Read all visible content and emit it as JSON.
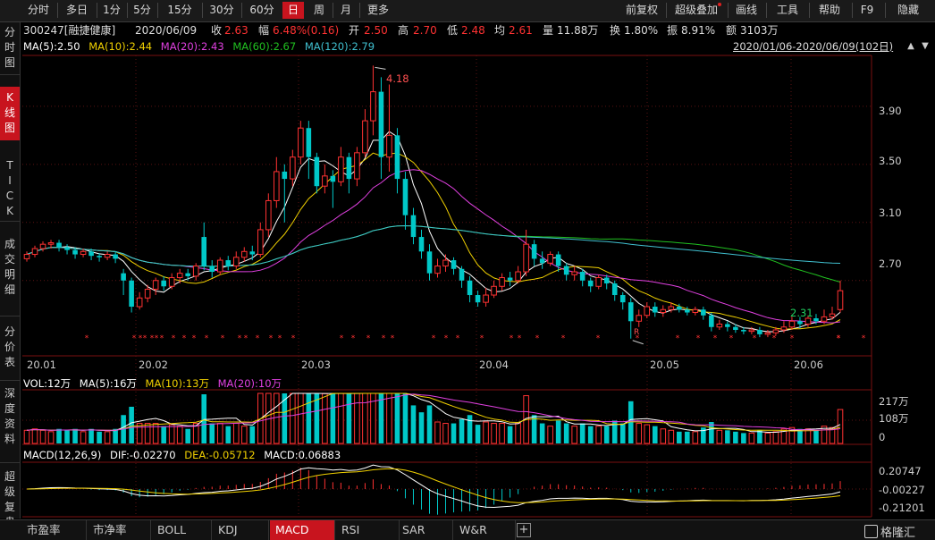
{
  "toolbar": {
    "periods": [
      "分时",
      "多日",
      "1分",
      "5分",
      "15分",
      "30分",
      "60分",
      "日",
      "周",
      "月",
      "更多"
    ],
    "selected": "日",
    "right": [
      "前复权",
      "超级叠加",
      "画线",
      "工具",
      "帮助",
      "F9",
      "隐藏"
    ]
  },
  "left_tabs": [
    "分时图",
    "K线图",
    "TICK",
    "成交明细",
    "分价表",
    "深度资料",
    "超级复盘"
  ],
  "left_selected": "K线图",
  "stock": {
    "code_name": "300247[融捷健康]",
    "date": "2020/06/09",
    "close_label": "收",
    "close": "2.63",
    "change_label": "幅",
    "change": "6.48%(0.16)",
    "open_label": "开",
    "open": "2.50",
    "high_label": "高",
    "high": "2.70",
    "low_label": "低",
    "low": "2.48",
    "avg_label": "均",
    "avg": "2.61",
    "volume_label": "量",
    "volume": "11.88万",
    "turnover_label": "换",
    "turnover": "1.80%",
    "amplitude_label": "振",
    "amplitude": "8.91%",
    "amount_label": "额",
    "amount": "3103万"
  },
  "ma": [
    {
      "label": "MA(5):2.50",
      "color": "#ffffff"
    },
    {
      "label": "MA(10):2.44",
      "color": "#f0d000"
    },
    {
      "label": "MA(20):2.43",
      "color": "#e040e0"
    },
    {
      "label": "MA(60):2.67",
      "color": "#20c020"
    },
    {
      "label": "MA(120):2.79",
      "color": "#40c0d0"
    }
  ],
  "date_range": "2020/01/06-2020/06/09(102日)",
  "price_axis": [
    "3.90",
    "3.50",
    "3.10",
    "2.70"
  ],
  "annotations": {
    "high": "4.18",
    "low": "2.31",
    "r_marker": "R"
  },
  "date_axis": [
    "20.01",
    "20.02",
    "20.03",
    "20.04",
    "20.05",
    "20.06"
  ],
  "vol_panel": {
    "labels": [
      {
        "text": "VOL:12万",
        "color": "#ffffff"
      },
      {
        "text": "MA(5):16万",
        "color": "#ffffff"
      },
      {
        "text": "MA(10):13万",
        "color": "#f0d000"
      },
      {
        "text": "MA(20):10万",
        "color": "#e040e0"
      }
    ],
    "axis": [
      "217万",
      "108万",
      "0"
    ]
  },
  "macd_panel": {
    "labels": [
      {
        "text": "MACD(12,26,9)",
        "color": "#ffffff"
      },
      {
        "text": "DIF:-0.02270",
        "color": "#ffffff"
      },
      {
        "text": "DEA:-0.05712",
        "color": "#f0d000"
      },
      {
        "text": "MACD:0.06883",
        "color": "#ffffff"
      }
    ],
    "axis": [
      "0.20747",
      "-0.00227",
      "-0.21201"
    ]
  },
  "bottom_tabs": [
    "市盈率",
    "市净率",
    "BOLL",
    "KDJ",
    "MACD",
    "RSI",
    "SAR",
    "W&R"
  ],
  "bottom_selected": "MACD",
  "logo": "格隆汇",
  "colors": {
    "up": "#ff3232",
    "down": "#00c8c8",
    "accent": "#c8141e"
  },
  "chart_data": {
    "type": "candlestick",
    "ylim": [
      2.2,
      4.25
    ],
    "candles": [
      [
        2.85,
        2.88,
        2.83,
        2.9
      ],
      [
        2.88,
        2.92,
        2.86,
        2.94
      ],
      [
        2.92,
        2.95,
        2.9,
        2.97
      ],
      [
        2.95,
        2.96,
        2.92,
        2.98
      ],
      [
        2.96,
        2.93,
        2.9,
        2.98
      ],
      [
        2.93,
        2.91,
        2.88,
        2.95
      ],
      [
        2.91,
        2.88,
        2.85,
        2.93
      ],
      [
        2.88,
        2.9,
        2.86,
        2.92
      ],
      [
        2.9,
        2.87,
        2.84,
        2.92
      ],
      [
        2.87,
        2.86,
        2.83,
        2.89
      ],
      [
        2.86,
        2.88,
        2.84,
        2.9
      ],
      [
        2.88,
        2.85,
        2.82,
        2.9
      ],
      [
        2.75,
        2.7,
        2.6,
        2.78
      ],
      [
        2.7,
        2.52,
        2.48,
        2.72
      ],
      [
        2.52,
        2.58,
        2.5,
        2.62
      ],
      [
        2.58,
        2.64,
        2.55,
        2.67
      ],
      [
        2.64,
        2.7,
        2.6,
        2.72
      ],
      [
        2.7,
        2.66,
        2.63,
        2.73
      ],
      [
        2.66,
        2.72,
        2.64,
        2.75
      ],
      [
        2.72,
        2.75,
        2.68,
        2.78
      ],
      [
        2.75,
        2.73,
        2.7,
        2.78
      ],
      [
        2.73,
        2.8,
        2.7,
        2.82
      ],
      [
        3.0,
        2.8,
        2.77,
        3.1
      ],
      [
        2.8,
        2.76,
        2.72,
        2.84
      ],
      [
        2.76,
        2.84,
        2.74,
        2.86
      ],
      [
        2.84,
        2.8,
        2.77,
        2.87
      ],
      [
        2.8,
        2.86,
        2.78,
        2.9
      ],
      [
        2.86,
        2.9,
        2.83,
        2.93
      ],
      [
        2.9,
        2.88,
        2.84,
        2.94
      ],
      [
        2.88,
        3.05,
        2.86,
        3.1
      ],
      [
        3.05,
        3.25,
        3.0,
        3.3
      ],
      [
        3.25,
        3.45,
        3.2,
        3.55
      ],
      [
        3.45,
        3.4,
        3.1,
        3.5
      ],
      [
        3.4,
        3.55,
        3.35,
        3.6
      ],
      [
        3.55,
        3.75,
        3.5,
        3.8
      ],
      [
        3.75,
        3.55,
        3.4,
        3.8
      ],
      [
        3.55,
        3.35,
        3.3,
        3.58
      ],
      [
        3.35,
        3.42,
        3.3,
        3.5
      ],
      [
        3.42,
        3.38,
        3.2,
        3.46
      ],
      [
        3.38,
        3.55,
        3.35,
        3.62
      ],
      [
        3.55,
        3.4,
        3.3,
        3.58
      ],
      [
        3.4,
        3.58,
        3.35,
        3.62
      ],
      [
        3.58,
        3.8,
        3.55,
        3.88
      ],
      [
        3.8,
        4.0,
        3.7,
        4.18
      ],
      [
        4.0,
        3.55,
        3.4,
        4.1
      ],
      [
        3.55,
        3.7,
        3.45,
        4.05
      ],
      [
        3.7,
        3.4,
        3.3,
        3.75
      ],
      [
        3.4,
        3.15,
        3.05,
        3.45
      ],
      [
        3.15,
        3.0,
        2.95,
        3.2
      ],
      [
        3.0,
        2.9,
        2.85,
        3.05
      ],
      [
        2.9,
        2.75,
        2.7,
        2.95
      ],
      [
        2.75,
        2.8,
        2.72,
        2.85
      ],
      [
        2.8,
        2.84,
        2.76,
        2.88
      ],
      [
        2.84,
        2.78,
        2.74,
        2.86
      ],
      [
        2.78,
        2.7,
        2.65,
        2.8
      ],
      [
        2.7,
        2.6,
        2.55,
        2.73
      ],
      [
        2.6,
        2.55,
        2.52,
        2.63
      ],
      [
        2.55,
        2.6,
        2.52,
        2.65
      ],
      [
        2.6,
        2.66,
        2.58,
        2.7
      ],
      [
        2.66,
        2.72,
        2.63,
        2.75
      ],
      [
        2.72,
        2.7,
        2.66,
        2.76
      ],
      [
        2.7,
        2.76,
        2.68,
        2.8
      ],
      [
        2.76,
        2.95,
        2.73,
        3.05
      ],
      [
        2.95,
        2.85,
        2.8,
        2.98
      ],
      [
        2.85,
        2.82,
        2.78,
        2.9
      ],
      [
        2.82,
        2.88,
        2.8,
        2.9
      ],
      [
        2.88,
        2.8,
        2.76,
        2.9
      ],
      [
        2.8,
        2.74,
        2.7,
        2.82
      ],
      [
        2.74,
        2.76,
        2.7,
        2.8
      ],
      [
        2.76,
        2.7,
        2.66,
        2.78
      ],
      [
        2.7,
        2.66,
        2.62,
        2.72
      ],
      [
        2.66,
        2.72,
        2.64,
        2.74
      ],
      [
        2.72,
        2.68,
        2.64,
        2.74
      ],
      [
        2.68,
        2.6,
        2.56,
        2.7
      ],
      [
        2.6,
        2.55,
        2.5,
        2.62
      ],
      [
        2.55,
        2.42,
        2.3,
        2.58
      ],
      [
        2.42,
        2.46,
        2.38,
        2.5
      ],
      [
        2.46,
        2.52,
        2.44,
        2.55
      ],
      [
        2.52,
        2.48,
        2.45,
        2.55
      ],
      [
        2.48,
        2.5,
        2.45,
        2.53
      ],
      [
        2.5,
        2.52,
        2.48,
        2.55
      ],
      [
        2.52,
        2.5,
        2.48,
        2.54
      ],
      [
        2.5,
        2.48,
        2.46,
        2.52
      ],
      [
        2.48,
        2.5,
        2.46,
        2.52
      ],
      [
        2.5,
        2.46,
        2.43,
        2.52
      ],
      [
        2.46,
        2.38,
        2.35,
        2.48
      ],
      [
        2.38,
        2.4,
        2.36,
        2.43
      ],
      [
        2.4,
        2.38,
        2.35,
        2.42
      ],
      [
        2.38,
        2.36,
        2.34,
        2.4
      ],
      [
        2.36,
        2.35,
        2.33,
        2.38
      ],
      [
        2.35,
        2.36,
        2.33,
        2.38
      ],
      [
        2.36,
        2.33,
        2.31,
        2.38
      ],
      [
        2.33,
        2.34,
        2.31,
        2.36
      ],
      [
        2.34,
        2.36,
        2.32,
        2.38
      ],
      [
        2.36,
        2.38,
        2.34,
        2.42
      ],
      [
        2.38,
        2.42,
        2.36,
        2.45
      ],
      [
        2.42,
        2.4,
        2.37,
        2.45
      ],
      [
        2.4,
        2.44,
        2.38,
        2.46
      ],
      [
        2.44,
        2.42,
        2.4,
        2.47
      ],
      [
        2.42,
        2.45,
        2.4,
        2.5
      ],
      [
        2.45,
        2.47,
        2.43,
        2.52
      ],
      [
        2.5,
        2.63,
        2.48,
        2.7
      ]
    ],
    "volume_max": 217
  }
}
